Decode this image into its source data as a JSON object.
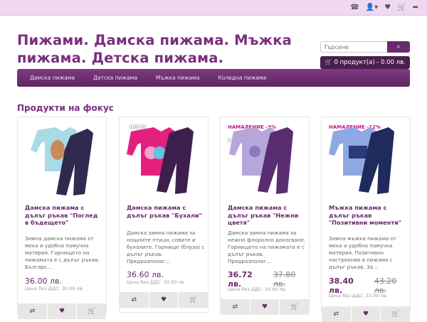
{
  "topbar": {
    "icons": [
      "phone-icon",
      "user-icon",
      "heart-icon",
      "cart-icon",
      "share-icon"
    ]
  },
  "header": {
    "title": "Пижами. Дамска пижама. Мъжка пижама. Детска пижама.",
    "search_placeholder": "Търсене",
    "cart_label": "0 продукт(а) - 0.00 лв."
  },
  "nav": {
    "items": [
      "Дамска пижама",
      "Детска пижама",
      "Мъжка пижама",
      "Коледна пижама"
    ]
  },
  "section": {
    "title": "Продукти на фокус"
  },
  "products": [
    {
      "title": "Дамска пижама с дълъг ръкав \"Поглед в бъдещето\"",
      "desc": "Зимна дамска пижама от мека и удобна памучна материя. Горнището на пижамата е с дълъг ръкав. Българс...",
      "price": "36.00 лв.",
      "old": "",
      "notax": "Цена без ДДС: 30.00 лв.",
      "badges": []
    },
    {
      "title": "Дамска пижама с дълъг ръкав \"Бухали\"",
      "desc": "Дамска зимна пижама за нощните птици, совите и бухалите. Горнище (блуза) с дълъг ръкав. Предразполаг...",
      "price": "36.60 лв.",
      "old": "",
      "notax": "Цена без ДДС: 30.50 лв.",
      "badges": [
        "НОВО"
      ]
    },
    {
      "title": "Дамска пижама с дълъг ръкав \"Нежни цветя\"",
      "desc": "Дамска зимна пижама за нежно флорално докосване. Горнището на пижамата е с дълъг ръкав. Предразполаг...",
      "price": "36.72 лв.",
      "old": "37.80 лв.",
      "notax": "Цена без ДДС: 30.60 лв.",
      "badges": [
        "НАМАЛЕНИЕ -3%",
        "НОВО"
      ]
    },
    {
      "title": "Мъжка пижама с дълъг ръкав \"Позитивни моменти\"",
      "desc": "Зимна мъжка пижама от мека и удобна памучна материя. Позитивно настроение в пижама с дълъг ръкав. За...",
      "price": "38.40 лв.",
      "old": "43.20 лв.",
      "notax": "Цена без ДДС: 32.00 лв.",
      "badges": [
        "НАМАЛЕНИЕ -12%"
      ]
    }
  ],
  "colors": {
    "brand": "#7a2f7d",
    "nav": "#6b2a6e",
    "topbar": "#f1d8f2"
  }
}
